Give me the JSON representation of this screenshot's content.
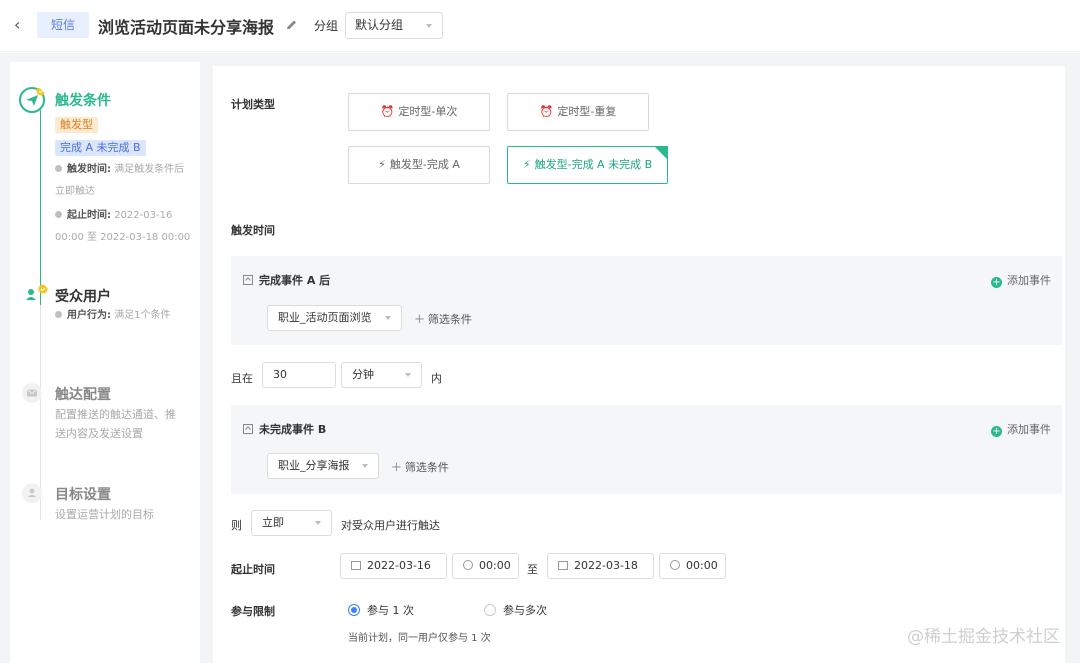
{
  "header": {
    "back_icon": "chevron-left-icon",
    "channel_tag": "短信",
    "title": "浏览活动页面未分享海报",
    "group_label": "分组",
    "group_value": "默认分组"
  },
  "sidebar": {
    "steps": [
      {
        "title": "触发条件",
        "badge_type": "触发型",
        "badge_event": "完成 A 未完成 B",
        "trigger_time_label": "触发时间:",
        "trigger_time_value_1": "满足触发条件后",
        "trigger_time_value_2": "立即触达",
        "period_label": "起止时间:",
        "period_value_1": "2022-03-16",
        "period_value_2": "00:00 至 2022-03-18 00:00"
      },
      {
        "title": "受众用户",
        "behavior_label": "用户行为:",
        "behavior_value": "满足1个条件"
      },
      {
        "title": "触达配置",
        "desc_1": "配置推送的触达通道、推",
        "desc_2": "送内容及发送设置"
      },
      {
        "title": "目标设置",
        "desc_1": "设置运营计划的目标"
      }
    ]
  },
  "main": {
    "plan_type_label": "计划类型",
    "plan_types": [
      "定时型-单次",
      "定时型-重复",
      "触发型-完成 A",
      "触发型-完成 A 未完成 B"
    ],
    "trigger_time_label": "触发时间",
    "event_a": {
      "title": "完成事件 A 后",
      "add_label": "添加事件",
      "event_value": "职业_活动页面浏览",
      "filter_label": "筛选条件"
    },
    "within": {
      "prefix": "且在",
      "value": "30",
      "unit": "分钟",
      "suffix": "内"
    },
    "event_b": {
      "title": "未完成事件 B",
      "add_label": "添加事件",
      "event_value": "职业_分享海报",
      "filter_label": "筛选条件"
    },
    "then": {
      "prefix": "则",
      "value": "立即",
      "suffix": "对受众用户进行触达"
    },
    "period": {
      "label": "起止时间",
      "start_date": "2022-03-16",
      "start_time": "00:00",
      "to": "至",
      "end_date": "2022-03-18",
      "end_time": "00:00"
    },
    "limit": {
      "label": "参与限制",
      "option_once": "参与 1 次",
      "option_multi": "参与多次",
      "note": "当前计划，同一用户仅参与 1 次"
    }
  },
  "watermark": "@稀土掘金技术社区",
  "colors": {
    "accent": "#2ab88f",
    "radio": "#3b82f6",
    "tag_bg": "#e8effe"
  }
}
